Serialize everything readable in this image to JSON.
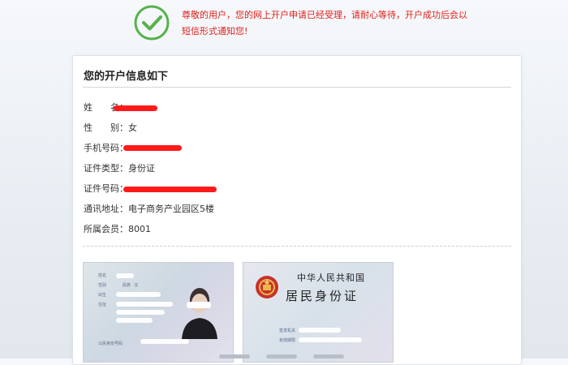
{
  "notice": {
    "line1": "尊敬的用户，您的网上开户申请已经受理，请耐心等待，开户成功后会以",
    "line2": "短信形式通知您!"
  },
  "card": {
    "title": "您的开户信息如下",
    "fields": [
      {
        "label": "姓　　名：",
        "value": ""
      },
      {
        "label": "性　　别：",
        "value": "女"
      },
      {
        "label": "手机号码：",
        "value": ""
      },
      {
        "label": "证件类型：",
        "value": "身份证"
      },
      {
        "label": "证件号码：",
        "value": ""
      },
      {
        "label": "通讯地址：",
        "value": "电子商务产业园区5楼"
      },
      {
        "label": "所属会员：",
        "value": "8001"
      }
    ]
  },
  "id_front": {
    "labels": [
      "姓名",
      "性别",
      "民族",
      "出生",
      "住址",
      "公民身份号码"
    ],
    "ethnicity_value": "汉"
  },
  "id_back": {
    "country": "中华人民共和国",
    "doc_title": "居民身份证",
    "labels": [
      "签发机关",
      "有效期限"
    ]
  },
  "colors": {
    "notice_text": "#e0201a",
    "check_green": "#55b24a",
    "redaction": "#ff1a1a"
  },
  "icons": {
    "success": "check-circle-icon"
  }
}
